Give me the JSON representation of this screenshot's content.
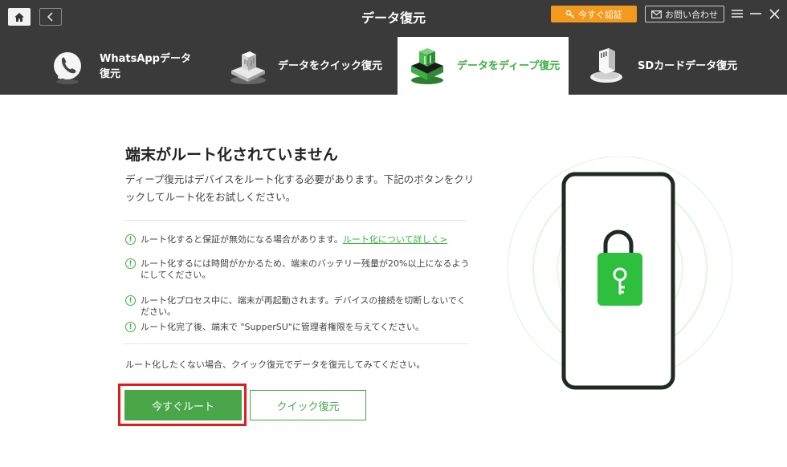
{
  "app": {
    "title": "データ復元"
  },
  "titlebar": {
    "register_label": "今すぐ認証",
    "contact_label": "お問い合わせ"
  },
  "tabs": [
    {
      "label": "WhatsAppデータ復元",
      "icon": "whatsapp-phone-icon",
      "active": false
    },
    {
      "label": "データをクイック復元",
      "icon": "quick-recovery-icon",
      "active": false
    },
    {
      "label": "データをディープ復元",
      "icon": "deep-recovery-icon",
      "active": true
    },
    {
      "label": "SDカードデータ復元",
      "icon": "sd-card-icon",
      "active": false
    }
  ],
  "main": {
    "heading": "端末がルート化されていません",
    "description": "ディープ復元はデバイスをルート化する必要があります。下記のボタンをクリックしてルート化をお試しください。",
    "notices": [
      {
        "text": "ルート化すると保証が無効になる場合があります。",
        "link": "ルート化について詳しく>"
      },
      {
        "text": "ルート化するには時間がかかるため、端末のバッテリー残量が20%以上になるようにしてください。"
      },
      {
        "text": "ルート化プロセス中に、端末が再起動されます。デバイスの接続を切断しないでください。"
      },
      {
        "text": "ルート化完了後、端末で \"SupperSU\"に管理者権限を与えてください。"
      }
    ],
    "footnote": "ルート化したくない場合、クイック復元でデータを復元してみてください。",
    "root_button": "今すぐルート",
    "quick_button": "クイック復元"
  },
  "colors": {
    "accent": "#3cb043",
    "dark_header": "#3a3a3a",
    "register": "#f39a1d",
    "highlight": "#e31b1b"
  }
}
